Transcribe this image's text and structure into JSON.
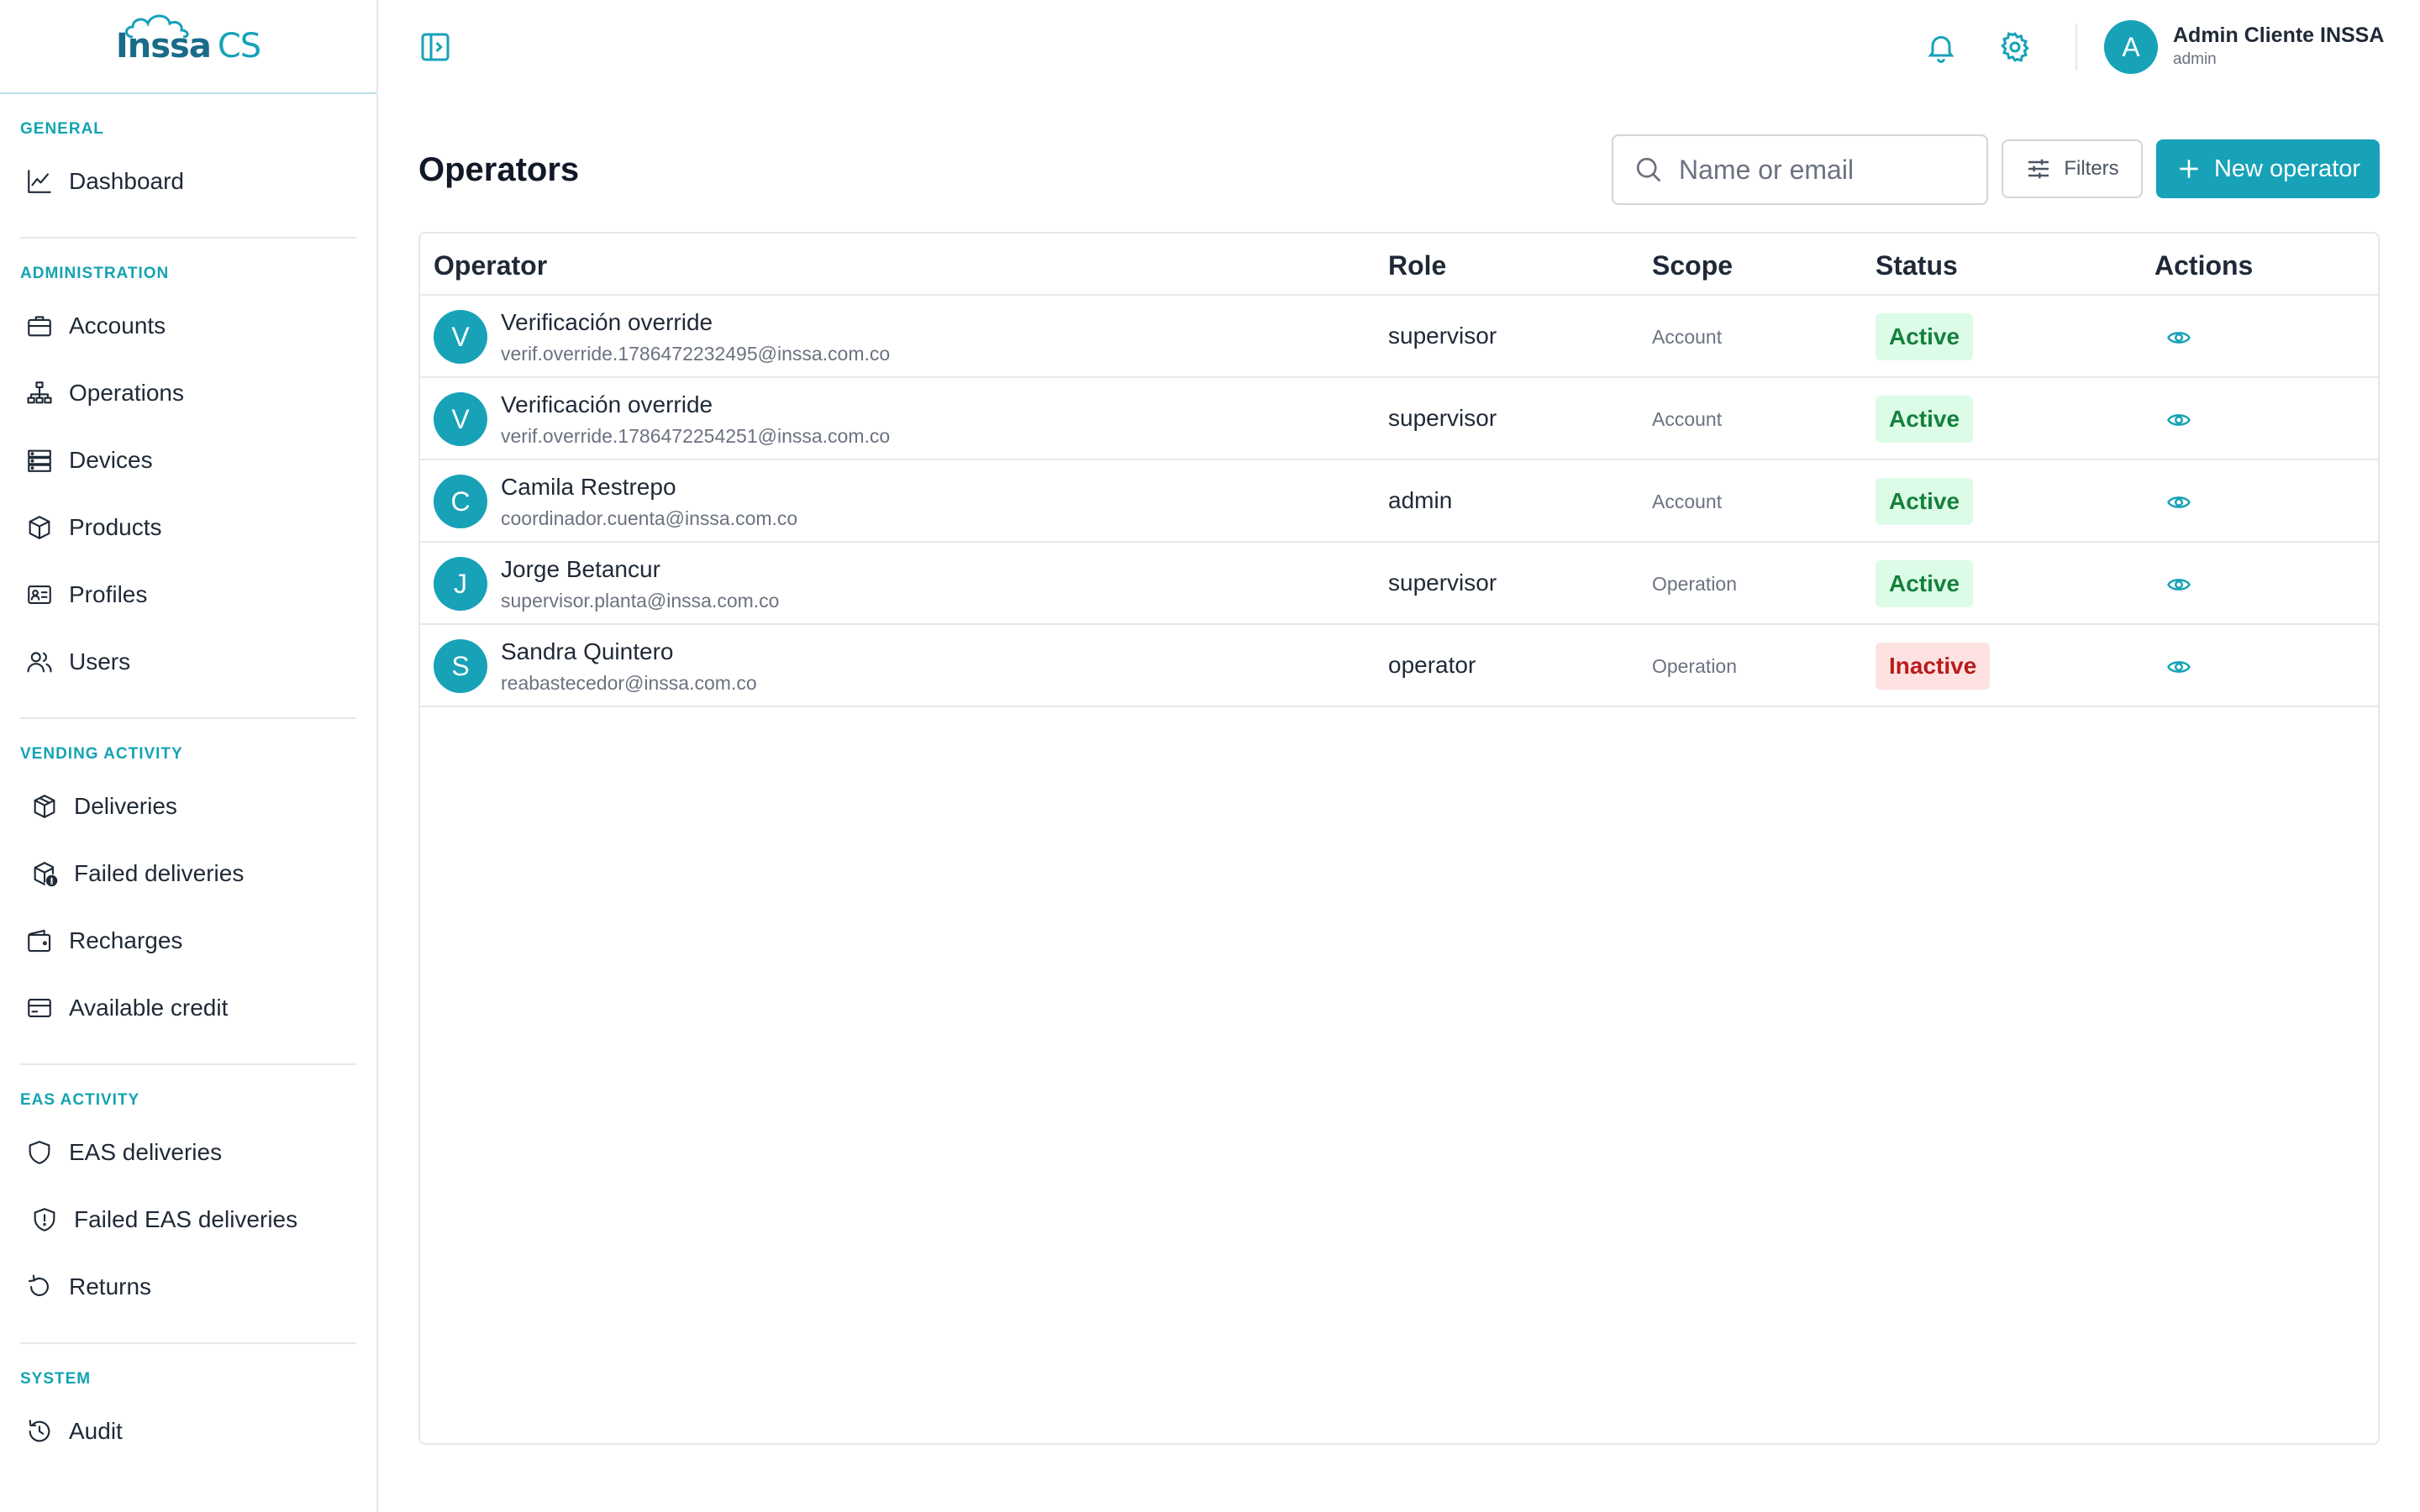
{
  "brand": {
    "logo_text": "Inssa",
    "logo_suffix": "CS",
    "accent": "#17a2b8"
  },
  "sidebar": {
    "sections": [
      {
        "title": "GENERAL",
        "items": [
          {
            "label": "Dashboard",
            "icon": "chart-line-icon"
          }
        ]
      },
      {
        "title": "ADMINISTRATION",
        "items": [
          {
            "label": "Accounts",
            "icon": "briefcase-icon"
          },
          {
            "label": "Operations",
            "icon": "hierarchy-icon"
          },
          {
            "label": "Devices",
            "icon": "server-icon"
          },
          {
            "label": "Products",
            "icon": "box-icon"
          },
          {
            "label": "Profiles",
            "icon": "id-card-icon"
          },
          {
            "label": "Users",
            "icon": "users-icon"
          }
        ]
      },
      {
        "title": "VENDING ACTIVITY",
        "items": [
          {
            "label": "Deliveries",
            "icon": "package-icon"
          },
          {
            "label": "Failed deliveries",
            "icon": "package-alert-icon"
          },
          {
            "label": "Recharges",
            "icon": "wallet-icon"
          },
          {
            "label": "Available credit",
            "icon": "credit-card-icon"
          }
        ]
      },
      {
        "title": "EAS ACTIVITY",
        "items": [
          {
            "label": "EAS deliveries",
            "icon": "shield-icon"
          },
          {
            "label": "Failed EAS deliveries",
            "icon": "shield-alert-icon"
          },
          {
            "label": "Returns",
            "icon": "rotate-icon"
          }
        ]
      },
      {
        "title": "SYSTEM",
        "items": [
          {
            "label": "Audit",
            "icon": "history-icon"
          }
        ]
      }
    ]
  },
  "header": {
    "user": {
      "initial": "A",
      "name": "Admin Cliente INSSA",
      "role": "admin"
    }
  },
  "main": {
    "title": "Operators",
    "search": {
      "placeholder": "Name or email",
      "value": ""
    },
    "filters_label": "Filters",
    "new_label": "New operator",
    "table": {
      "columns": [
        "Operator",
        "Role",
        "Scope",
        "Status",
        "Actions"
      ],
      "rows": [
        {
          "initial": "V",
          "name": "Verificación override",
          "email": "verif.override.1786472232495@inssa.com.co",
          "role": "supervisor",
          "scope": "Account",
          "status": "Active"
        },
        {
          "initial": "V",
          "name": "Verificación override",
          "email": "verif.override.1786472254251@inssa.com.co",
          "role": "supervisor",
          "scope": "Account",
          "status": "Active"
        },
        {
          "initial": "C",
          "name": "Camila Restrepo",
          "email": "coordinador.cuenta@inssa.com.co",
          "role": "admin",
          "scope": "Account",
          "status": "Active"
        },
        {
          "initial": "J",
          "name": "Jorge Betancur",
          "email": "supervisor.planta@inssa.com.co",
          "role": "supervisor",
          "scope": "Operation",
          "status": "Active"
        },
        {
          "initial": "S",
          "name": "Sandra Quintero",
          "email": "reabastecedor@inssa.com.co",
          "role": "operator",
          "scope": "Operation",
          "status": "Inactive"
        }
      ]
    }
  }
}
